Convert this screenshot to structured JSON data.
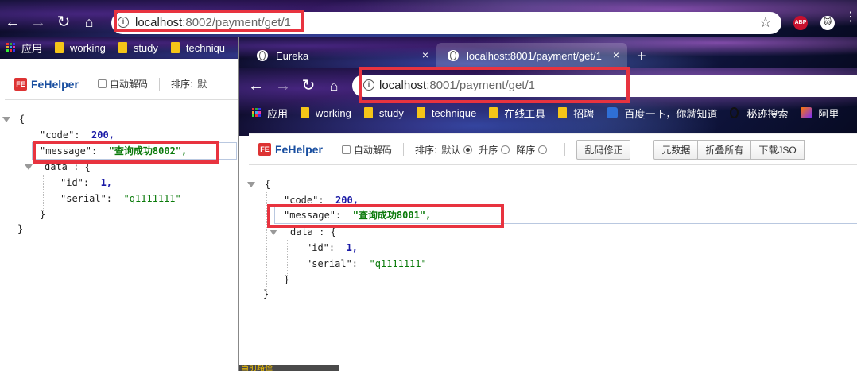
{
  "window_back": {
    "address": {
      "host": "localhost",
      "path": ":8002/payment/get/1"
    },
    "bookmarks": [
      "应用",
      "working",
      "study",
      "techniqu"
    ],
    "fehelper": {
      "logo": "FeHelper",
      "auto_decode": "自动解码",
      "sort_label": "排序:",
      "sort_default": "默"
    },
    "json": {
      "open_brace": "{",
      "code_key": "\"code\":",
      "code_val": "200,",
      "message_key": "\"message\":",
      "message_val": "\"查询成功8002\",",
      "data_key": "data :",
      "data_brace": "{",
      "id_key": "\"id\":",
      "id_val": "1,",
      "serial_key": "\"serial\":",
      "serial_val": "\"q1111111\"",
      "inner_close": "}",
      "outer_close": "}"
    }
  },
  "window_front": {
    "tabs": [
      {
        "title": "Eureka",
        "close": "×"
      },
      {
        "title": "localhost:8001/payment/get/1",
        "close": "×"
      }
    ],
    "new_tab": "+",
    "address": {
      "host": "localhost",
      "path": ":8001/payment/get/1"
    },
    "bookmarks": [
      "应用",
      "working",
      "study",
      "technique",
      "在线工具",
      "招聘",
      "百度一下，你就知道",
      "秘迹搜索",
      "阿里"
    ],
    "fehelper": {
      "logo": "FeHelper",
      "auto_decode": "自动解码",
      "sort_label": "排序:",
      "sort_default": "默认",
      "sort_asc": "升序",
      "sort_desc": "降序",
      "fix_encoding": "乱码修正",
      "raw_data": "元数据",
      "collapse_all": "折叠所有",
      "download": "下载JSO"
    },
    "json": {
      "open_brace": "{",
      "code_key": "\"code\":",
      "code_val": "200,",
      "message_key": "\"message\":",
      "message_val": "\"查询成功8001\",",
      "data_key": "data :",
      "data_brace": "{",
      "id_key": "\"id\":",
      "id_val": "1,",
      "serial_key": "\"serial\":",
      "serial_val": "\"q1111111\"",
      "inner_close": "}",
      "outer_close": "}"
    },
    "bottom_tip": "当前路径"
  },
  "colors": {
    "highlight_box": "#e8333f",
    "json_string": "#0a7a0a",
    "json_number": "#1a1aa6",
    "fehelper_brand": "#1a4fa0"
  },
  "icons": [
    "back-arrow-icon",
    "forward-arrow-icon",
    "reload-icon",
    "home-icon",
    "info-icon",
    "star-icon",
    "abp-icon",
    "extension-cat-icon",
    "menu-dots-icon",
    "apps-grid-icon",
    "folder-icon",
    "globe-icon"
  ]
}
